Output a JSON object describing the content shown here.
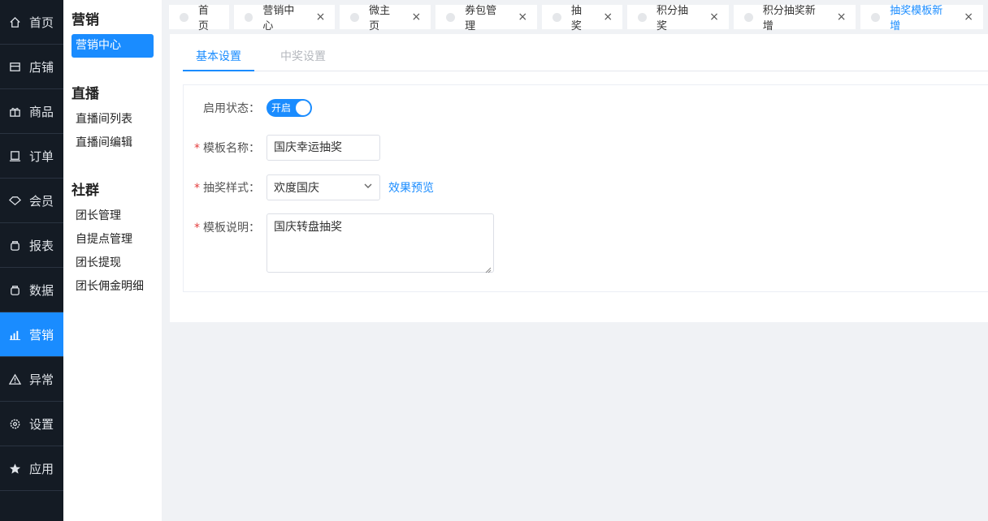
{
  "nav": {
    "items": [
      {
        "label": "首页",
        "icon": "home-icon"
      },
      {
        "label": "店铺",
        "icon": "shop-icon"
      },
      {
        "label": "商品",
        "icon": "gift-icon"
      },
      {
        "label": "订单",
        "icon": "order-icon"
      },
      {
        "label": "会员",
        "icon": "member-icon"
      },
      {
        "label": "报表",
        "icon": "report-icon"
      },
      {
        "label": "数据",
        "icon": "data-icon"
      },
      {
        "label": "营销",
        "icon": "marketing-icon"
      },
      {
        "label": "异常",
        "icon": "warning-icon"
      },
      {
        "label": "设置",
        "icon": "gear-icon"
      },
      {
        "label": "应用",
        "icon": "star-icon"
      }
    ],
    "active_index": 7
  },
  "submenu": {
    "group1": "营销",
    "group1_items": [
      "营销中心"
    ],
    "group2": "直播",
    "group2_items": [
      "直播间列表",
      "直播间编辑"
    ],
    "group3": "社群",
    "group3_items": [
      "团长管理",
      "自提点管理",
      "团长提现",
      "团长佣金明细"
    ]
  },
  "tabs": [
    {
      "label": "首页",
      "closable": false
    },
    {
      "label": "营销中心",
      "closable": true
    },
    {
      "label": "微主页",
      "closable": true
    },
    {
      "label": "券包管理",
      "closable": true
    },
    {
      "label": "抽奖",
      "closable": true
    },
    {
      "label": "积分抽奖",
      "closable": true
    },
    {
      "label": "积分抽奖新增",
      "closable": true
    },
    {
      "label": "抽奖模板新增",
      "closable": true
    }
  ],
  "close_glyph": "×",
  "panel": {
    "tab_basic": "基本设置",
    "tab_prize": "中奖设置"
  },
  "form": {
    "status_label": "启用状态：",
    "status_value": "开启",
    "name_label": "模板名称：",
    "name_value": "国庆幸运抽奖",
    "style_label": "抽奖样式：",
    "style_value": "欢度国庆",
    "preview_link": "效果预览",
    "desc_label": "模板说明：",
    "desc_value": "国庆转盘抽奖",
    "required_mark": "*"
  },
  "colors": {
    "primary": "#1a8cff",
    "sidebar_bg": "#141b24",
    "required": "#e43c3c"
  }
}
